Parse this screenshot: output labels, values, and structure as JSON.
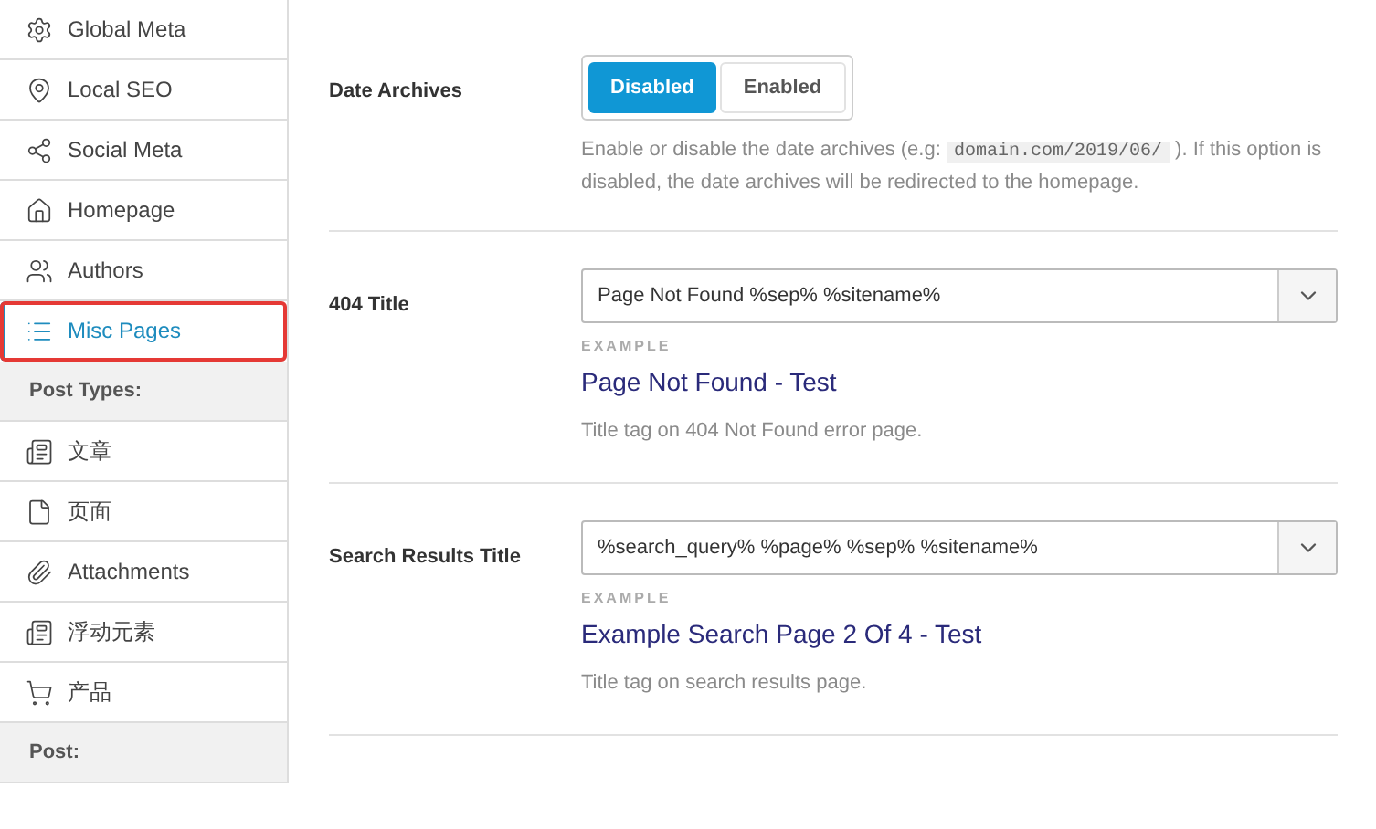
{
  "sidebar": {
    "items": [
      {
        "kind": "item",
        "label": "Global Meta",
        "selected": false,
        "highlighted": false
      },
      {
        "kind": "item",
        "label": "Local SEO",
        "selected": false,
        "highlighted": false
      },
      {
        "kind": "item",
        "label": "Social Meta",
        "selected": false,
        "highlighted": false
      },
      {
        "kind": "item",
        "label": "Homepage",
        "selected": false,
        "highlighted": false
      },
      {
        "kind": "item",
        "label": "Authors",
        "selected": false,
        "highlighted": false
      },
      {
        "kind": "item",
        "label": "Misc Pages",
        "selected": true,
        "highlighted": true
      },
      {
        "kind": "heading",
        "label": "Post Types:"
      },
      {
        "kind": "item",
        "label": "文章",
        "selected": false,
        "highlighted": false
      },
      {
        "kind": "item",
        "label": "页面",
        "selected": false,
        "highlighted": false
      },
      {
        "kind": "item",
        "label": "Attachments",
        "selected": false,
        "highlighted": false
      },
      {
        "kind": "item",
        "label": "浮动元素",
        "selected": false,
        "highlighted": false
      },
      {
        "kind": "item",
        "label": "产品",
        "selected": false,
        "highlighted": false
      },
      {
        "kind": "heading",
        "label": "Post:"
      }
    ]
  },
  "settings": [
    {
      "kind": "toggle",
      "label": "Date Archives",
      "options": [
        {
          "label": "Disabled",
          "selected": true
        },
        {
          "label": "Enabled",
          "selected": false
        }
      ],
      "description": {
        "before": "Enable or disable the date archives (e.g: ",
        "code": "domain.com/2019/06/",
        "after": " ). If this option is disabled, the date archives will be redirected to the homepage."
      }
    },
    {
      "kind": "select",
      "label": "404 Title",
      "value": "Page Not Found %sep% %sitename%",
      "example_label": "EXAMPLE",
      "example": "Page Not Found - Test",
      "description": {
        "before": "Title tag on 404 Not Found error page."
      }
    },
    {
      "kind": "select",
      "label": "Search Results Title",
      "value": "%search_query% %page% %sep% %sitename%",
      "example_label": "EXAMPLE",
      "example": "Example Search Page 2 Of 4 - Test",
      "description": {
        "before": "Title tag on search results page."
      }
    }
  ]
}
